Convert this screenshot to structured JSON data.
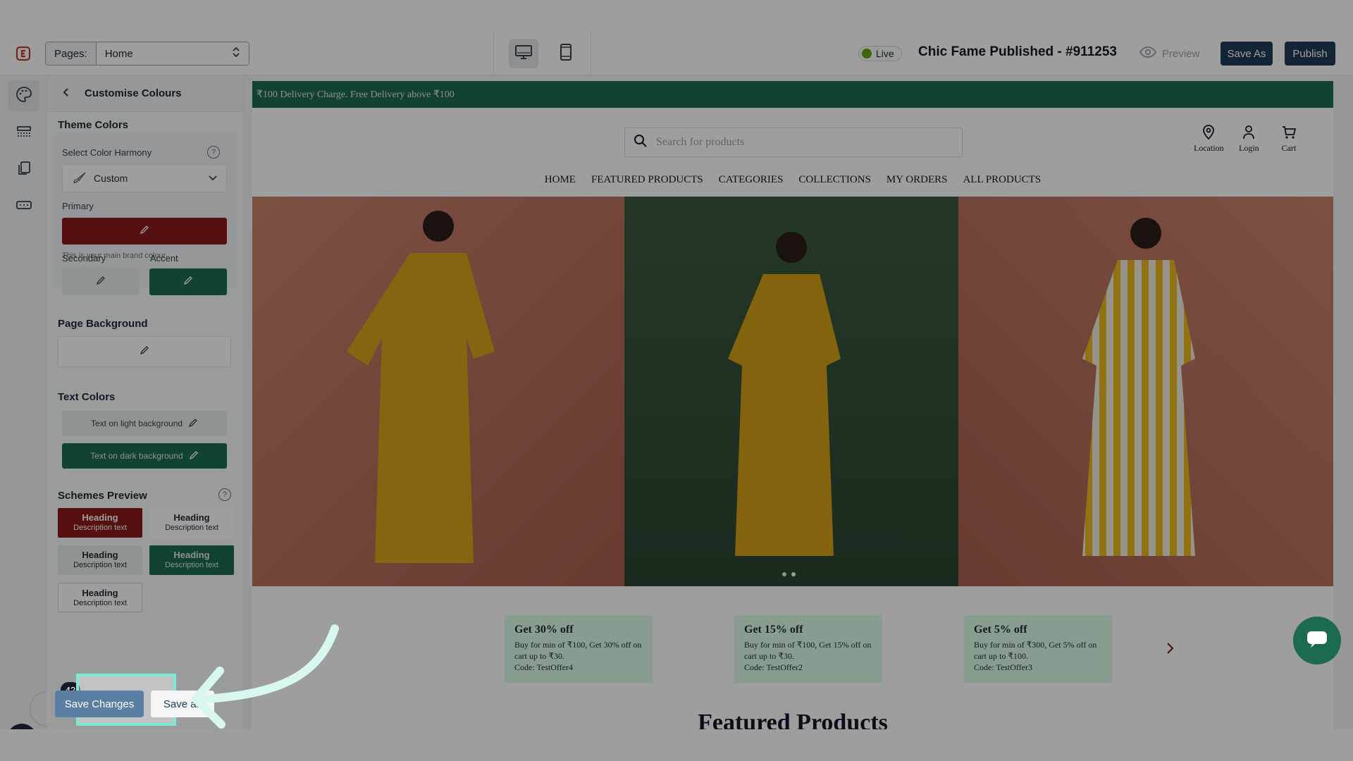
{
  "topbar": {
    "pages_label": "Pages:",
    "page_value": "Home",
    "live_label": "Live",
    "site_title": "Chic Fame Published - #911253",
    "preview_label": "Preview",
    "save_as_label": "Save As",
    "publish_label": "Publish"
  },
  "panel": {
    "title": "Customise Colours",
    "theme_colors_title": "Theme Colors",
    "harmony_label": "Select Color Harmony",
    "harmony_value": "Custom",
    "primary_label": "Primary",
    "primary_hint": "This is your main brand colour",
    "secondary_label": "Secondary",
    "accent_label": "Accent",
    "page_bg_title": "Page Background",
    "text_colors_title": "Text Colors",
    "text_light_label": "Text on light background",
    "text_dark_label": "Text on dark background",
    "schemes_title": "Schemes Preview",
    "schemes": [
      {
        "heading": "Heading",
        "desc": "Description text"
      },
      {
        "heading": "Heading",
        "desc": "Description text"
      },
      {
        "heading": "Heading",
        "desc": "Description text"
      },
      {
        "heading": "Heading",
        "desc": "Description text"
      },
      {
        "heading": "Heading",
        "desc": "Description text"
      }
    ],
    "save_changes_label": "Save Changes",
    "save_as_label": "Save as",
    "badge_count": "42"
  },
  "colors": {
    "primary": "#8b1a1a",
    "secondary": "#e5f0e9",
    "accent": "#1d6b4f",
    "banner": "#1d6b4f",
    "offer_bg": "#dcfce7"
  },
  "site": {
    "banner_text": "₹100 Delivery Charge. Free Delivery above ₹100",
    "search_placeholder": "Search for products",
    "header_icons": [
      {
        "label": "Location",
        "icon": "location-pin-icon"
      },
      {
        "label": "Login",
        "icon": "user-icon"
      },
      {
        "label": "Cart",
        "icon": "cart-icon"
      }
    ],
    "nav": [
      "HOME",
      "FEATURED PRODUCTS",
      "CATEGORIES",
      "COLLECTIONS",
      "MY ORDERS",
      "ALL PRODUCTS"
    ],
    "offers": [
      {
        "title": "Get 30% off",
        "desc": "Buy for min of ₹100, Get 30% off on cart up to ₹30.",
        "code": "Code: TestOffer4"
      },
      {
        "title": "Get 15% off",
        "desc": "Buy for min of ₹100, Get 15% off on cart up to ₹30.",
        "code": "Code: TestOffer2"
      },
      {
        "title": "Get 5% off",
        "desc": "Buy for min of ₹300, Get 5% off on cart up to ₹100.",
        "code": "Code: TestOffer3"
      }
    ],
    "featured_title": "Featured Products"
  }
}
